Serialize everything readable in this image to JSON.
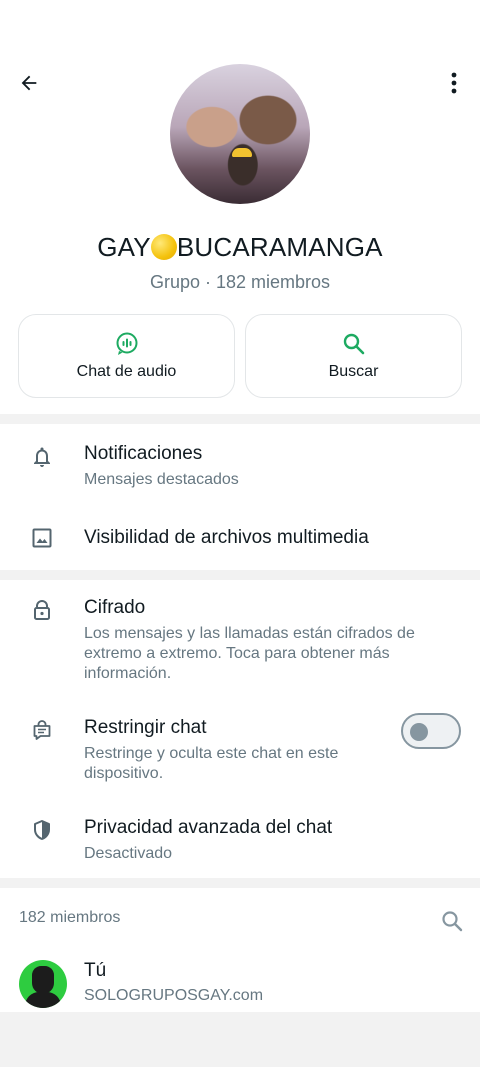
{
  "header": {
    "group_name_part1": "GAY",
    "group_name_part2": "BUCARAMANGA",
    "subtitle": "Grupo · 182 miembros"
  },
  "actions": {
    "audio_chat_label": "Chat de audio",
    "search_label": "Buscar"
  },
  "settings": {
    "notifications": {
      "title": "Notificaciones",
      "subtitle": "Mensajes destacados"
    },
    "media_visibility": {
      "title": "Visibilidad de archivos multimedia"
    },
    "encryption": {
      "title": "Cifrado",
      "subtitle": "Los mensajes y las llamadas están cifrados de extremo a extremo. Toca para obtener más información."
    },
    "restrict_chat": {
      "title": "Restringir chat",
      "subtitle": "Restringe y oculta este chat en este dispositivo.",
      "enabled": false
    },
    "advanced_privacy": {
      "title": "Privacidad avanzada del chat",
      "subtitle": "Desactivado"
    }
  },
  "members": {
    "count_label": "182 miembros",
    "list": [
      {
        "name": "Tú",
        "status": "SOLOGRUPOSGAY.com"
      }
    ]
  },
  "colors": {
    "accent_green": "#1daa61",
    "text_primary": "#111b21",
    "text_secondary": "#667781",
    "icon_gray": "#54656f"
  }
}
